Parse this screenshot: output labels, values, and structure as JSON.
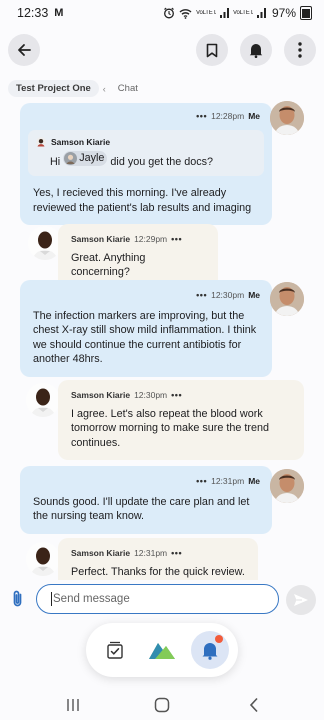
{
  "status_bar": {
    "time": "12:33",
    "mail_glyph": "M",
    "signal1": "VoLTE LTE1",
    "signal2": "VoLTE LTE2",
    "battery": "97%"
  },
  "header": {
    "back_icon": "back-arrow-icon",
    "bookmark_icon": "bookmark-icon",
    "bell_icon": "bell-icon",
    "more_icon": "more-vertical-icon"
  },
  "breadcrumb": {
    "project": "Test Project One",
    "separator": "‹",
    "current": "Chat"
  },
  "messages": [
    {
      "id": "m1",
      "from": "Me",
      "time": "12:28pm",
      "reply_to": {
        "sender": "Samson Kiarie",
        "text_before": "Hi",
        "mention": "Jayle",
        "text_after": "did you get the docs?"
      },
      "text": "Yes, I recieved this morning. I've already reviewed the patient's lab results and imaging"
    },
    {
      "id": "m2",
      "from": "Samson Kiarie",
      "time": "12:29pm",
      "text": "Great. Anything concerning?"
    },
    {
      "id": "m3",
      "from": "Me",
      "time": "12:30pm",
      "text": "The infection markers are improving, but the chest X-ray still show mild inflammation. I think we should continue the current antibiotis for another 48hrs."
    },
    {
      "id": "m4",
      "from": "Samson Kiarie",
      "time": "12:30pm",
      "text": "I agree. Let's also repeat the blood work tomorrow morning to make sure the trend continues."
    },
    {
      "id": "m5",
      "from": "Me",
      "time": "12:31pm",
      "text": "Sounds good. I'll update the care plan and let the nursing team know."
    },
    {
      "id": "m6",
      "from": "Samson Kiarie",
      "time": "12:31pm",
      "text": "Perfect. Thanks for the quick review."
    }
  ],
  "labels": {
    "me": "Me",
    "dots": "•••"
  },
  "composer": {
    "placeholder": "Send message",
    "attach_icon": "paperclip-icon",
    "send_icon": "send-icon"
  },
  "dock": {
    "items": [
      "tasks-icon",
      "mountain-app-icon",
      "notification-bell-icon"
    ],
    "active": "notification-bell-icon"
  },
  "nav_bar": {
    "recent_icon": "recent-apps-icon",
    "home_icon": "home-icon",
    "back_icon": "nav-back-icon"
  },
  "colors": {
    "accent": "#3978c4",
    "me_bubble": "#dcecf9",
    "other_bubble": "#f6f3ec",
    "badge": "#f25c3b"
  }
}
